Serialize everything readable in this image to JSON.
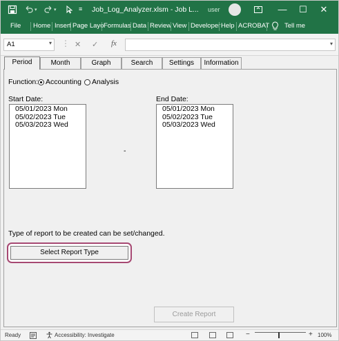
{
  "app": {
    "title": "Job_Log_Analyzer.xlsm  -  Job L...",
    "user_name": "user",
    "window_buttons": {
      "minimize": "—",
      "restore": "☐",
      "close": "✕"
    }
  },
  "ribbon": {
    "tabs": [
      "File",
      "Home",
      "Insert",
      "Page Layo",
      "Formulas",
      "Data",
      "Review",
      "View",
      "Developer",
      "Help",
      "ACROBAT"
    ],
    "tell_me": "Tell me"
  },
  "formula_bar": {
    "name_box": "A1",
    "fx": "fx",
    "formula": ""
  },
  "form": {
    "tabs": [
      "Period",
      "Month",
      "Graph",
      "Search",
      "Settings",
      "Information"
    ],
    "active_tab": "Period",
    "function_label": "Function:",
    "options": [
      "Accounting",
      "Analysis"
    ],
    "selected_option": "Accounting",
    "start_label": "Start Date:",
    "end_label": "End Date:",
    "separator": "-",
    "start_dates": [
      "05/01/2023 Mon",
      "05/02/2023 Tue",
      "05/03/2023 Wed"
    ],
    "end_dates": [
      "05/01/2023 Mon",
      "05/02/2023 Tue",
      "05/03/2023 Wed"
    ],
    "report_info": "Type of report to be created can be set/changed.",
    "select_button": "Select Report Type",
    "create_button": "Create Report"
  },
  "status": {
    "ready": "Ready",
    "accessibility": "Accessibility: Investigate",
    "zoom_minus": "−",
    "zoom_plus": "+",
    "zoom": "100%"
  },
  "colors": {
    "excel_green": "#217346",
    "highlight": "#a64872"
  }
}
